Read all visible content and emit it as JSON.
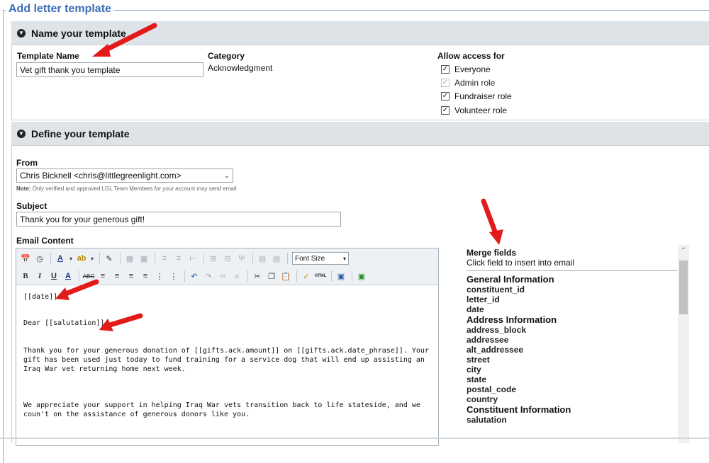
{
  "page_title": "Add letter template",
  "section1": {
    "title": "Name your template",
    "template_name_label": "Template Name",
    "template_name_value": "Vet gift thank you template",
    "category_label": "Category",
    "category_value": "Acknowledgment",
    "access_label": "Allow access for",
    "access_options": [
      {
        "label": "Everyone",
        "checked": true,
        "disabled": false
      },
      {
        "label": "Admin role",
        "checked": true,
        "disabled": true
      },
      {
        "label": "Fundraiser role",
        "checked": true,
        "disabled": false
      },
      {
        "label": "Volunteer role",
        "checked": true,
        "disabled": false
      }
    ]
  },
  "section2": {
    "title": "Define your template",
    "from_label": "From",
    "from_value": "Chris Bicknell <chris@littlegreenlight.com>",
    "note_prefix": "Note:",
    "note_text": "Only verified and approved LGL Team Members for your account may send email",
    "subject_label": "Subject",
    "subject_value": "Thank you for your generous gift!",
    "email_content_label": "Email Content",
    "font_size_label": "Font Size",
    "editor_lines": {
      "date": "[[date]]",
      "salutation": "Dear [[salutation]],",
      "para1": "Thank you for your generous donation of [[gifts.ack.amount]] on [[gifts.ack.date_phrase]]. Your gift has been used just today to fund training for a service dog that will end up assisting an Iraq War vet returning home next week.",
      "para2": "We appreciate your support in helping Iraq War vets transition back to life stateside, and we coun't on the assistance of generous donors like you."
    }
  },
  "merge": {
    "title": "Merge fields",
    "subtitle": "Click field to insert into email",
    "groups": [
      {
        "heading": "General Information",
        "fields": [
          "constituent_id",
          "letter_id",
          "date"
        ]
      },
      {
        "heading": "Address Information",
        "fields": [
          "address_block",
          "addressee",
          "alt_addressee",
          "street",
          "city",
          "state",
          "postal_code",
          "country"
        ]
      },
      {
        "heading": "Constituent Information",
        "fields": [
          "salutation"
        ]
      }
    ]
  },
  "colors": {
    "legend": "#3b6db4",
    "section_bg": "#dde3e7",
    "arrow": "#e31a1a"
  },
  "icons": [
    "chevron-circle-icon",
    "checkbox-icon",
    "dropdown-arrow-icon",
    "bold-icon",
    "italic-icon",
    "underline-icon",
    "undo-icon",
    "cut-icon",
    "copy-icon",
    "paste-icon",
    "html-icon",
    "image-icon",
    "scroll-up-icon",
    "red-arrow-annotation"
  ]
}
